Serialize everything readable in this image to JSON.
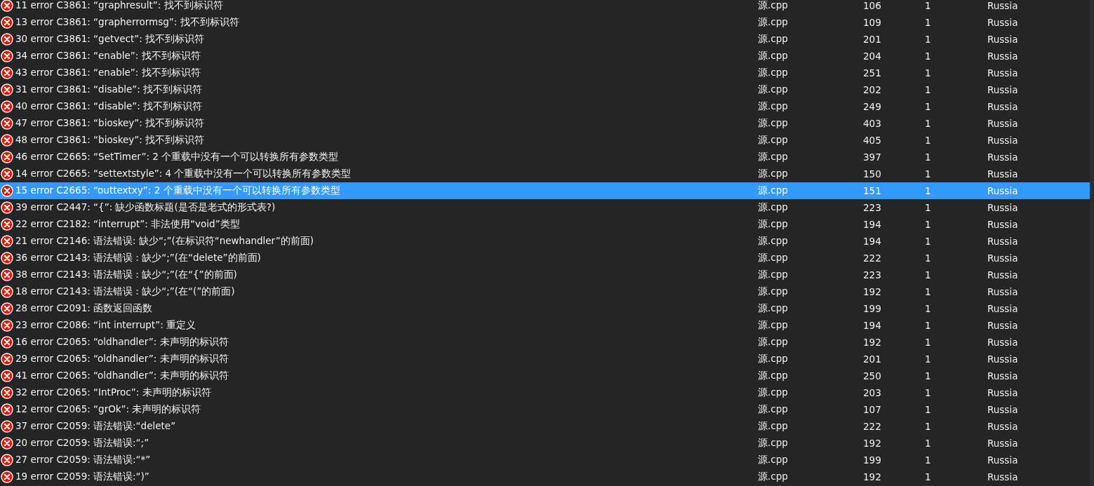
{
  "rows": [
    {
      "column_1": "11 error C3861: “graphresult”:  找不到标识符",
      "column_2": "源.cpp",
      "column_3": "106",
      "column_4": "1",
      "column_5": "Russia",
      "selected": false
    },
    {
      "column_1": "13 error C3861: “grapherrormsg”:  找不到标识符",
      "column_2": "源.cpp",
      "column_3": "109",
      "column_4": "1",
      "column_5": "Russia",
      "selected": false
    },
    {
      "column_1": "30 error C3861: “getvect”:  找不到标识符",
      "column_2": "源.cpp",
      "column_3": "201",
      "column_4": "1",
      "column_5": "Russia",
      "selected": false
    },
    {
      "column_1": "34 error C3861: “enable”:  找不到标识符",
      "column_2": "源.cpp",
      "column_3": "204",
      "column_4": "1",
      "column_5": "Russia",
      "selected": false
    },
    {
      "column_1": "43 error C3861: “enable”:  找不到标识符",
      "column_2": "源.cpp",
      "column_3": "251",
      "column_4": "1",
      "column_5": "Russia",
      "selected": false
    },
    {
      "column_1": "31 error C3861: “disable”:  找不到标识符",
      "column_2": "源.cpp",
      "column_3": "202",
      "column_4": "1",
      "column_5": "Russia",
      "selected": false
    },
    {
      "column_1": "40 error C3861: “disable”:  找不到标识符",
      "column_2": "源.cpp",
      "column_3": "249",
      "column_4": "1",
      "column_5": "Russia",
      "selected": false
    },
    {
      "column_1": "47 error C3861: “bioskey”:  找不到标识符",
      "column_2": "源.cpp",
      "column_3": "403",
      "column_4": "1",
      "column_5": "Russia",
      "selected": false
    },
    {
      "column_1": "48 error C3861: “bioskey”:  找不到标识符",
      "column_2": "源.cpp",
      "column_3": "405",
      "column_4": "1",
      "column_5": "Russia",
      "selected": false
    },
    {
      "column_1": "46 error C2665: “SetTimer”: 2 个重载中没有一个可以转换所有参数类型",
      "column_2": "源.cpp",
      "column_3": "397",
      "column_4": "1",
      "column_5": "Russia",
      "selected": false
    },
    {
      "column_1": "14 error C2665: “settextstyle”: 4 个重载中没有一个可以转换所有参数类型",
      "column_2": "源.cpp",
      "column_3": "150",
      "column_4": "1",
      "column_5": "Russia",
      "selected": false
    },
    {
      "column_1": "15 error C2665: “outtextxy”: 2 个重载中没有一个可以转换所有参数类型",
      "column_2": "源.cpp",
      "column_3": "151",
      "column_4": "1",
      "column_5": "Russia",
      "selected": true
    },
    {
      "column_1": "39 error C2447: “{”: 缺少函数标题(是否是老式的形式表?)",
      "column_2": "源.cpp",
      "column_3": "223",
      "column_4": "1",
      "column_5": "Russia",
      "selected": false
    },
    {
      "column_1": "22 error C2182: “interrupt”: 非法使用“void”类型",
      "column_2": "源.cpp",
      "column_3": "194",
      "column_4": "1",
      "column_5": "Russia",
      "selected": false
    },
    {
      "column_1": "21 error C2146: 语法错误: 缺少“;”(在标识符“newhandler”的前面)",
      "column_2": "源.cpp",
      "column_3": "194",
      "column_4": "1",
      "column_5": "Russia",
      "selected": false
    },
    {
      "column_1": "36 error C2143: 语法错误 : 缺少“;”(在“delete”的前面)",
      "column_2": "源.cpp",
      "column_3": "222",
      "column_4": "1",
      "column_5": "Russia",
      "selected": false
    },
    {
      "column_1": "38 error C2143: 语法错误 : 缺少“;”(在“{”的前面)",
      "column_2": "源.cpp",
      "column_3": "223",
      "column_4": "1",
      "column_5": "Russia",
      "selected": false
    },
    {
      "column_1": "18 error C2143: 语法错误 : 缺少“;”(在“(”的前面)",
      "column_2": "源.cpp",
      "column_3": "192",
      "column_4": "1",
      "column_5": "Russia",
      "selected": false
    },
    {
      "column_1": "28 error C2091: 函数返回函数",
      "column_2": "源.cpp",
      "column_3": "199",
      "column_4": "1",
      "column_5": "Russia",
      "selected": false
    },
    {
      "column_1": "23 error C2086: “int interrupt”: 重定义",
      "column_2": "源.cpp",
      "column_3": "194",
      "column_4": "1",
      "column_5": "Russia",
      "selected": false
    },
    {
      "column_1": "16 error C2065: “oldhandler”: 未声明的标识符",
      "column_2": "源.cpp",
      "column_3": "192",
      "column_4": "1",
      "column_5": "Russia",
      "selected": false
    },
    {
      "column_1": "29 error C2065: “oldhandler”: 未声明的标识符",
      "column_2": "源.cpp",
      "column_3": "201",
      "column_4": "1",
      "column_5": "Russia",
      "selected": false
    },
    {
      "column_1": "41 error C2065: “oldhandler”: 未声明的标识符",
      "column_2": "源.cpp",
      "column_3": "250",
      "column_4": "1",
      "column_5": "Russia",
      "selected": false
    },
    {
      "column_1": "32 error C2065: “IntProc”: 未声明的标识符",
      "column_2": "源.cpp",
      "column_3": "203",
      "column_4": "1",
      "column_5": "Russia",
      "selected": false
    },
    {
      "column_1": "12 error C2065: “grOk”: 未声明的标识符",
      "column_2": "源.cpp",
      "column_3": "107",
      "column_4": "1",
      "column_5": "Russia",
      "selected": false
    },
    {
      "column_1": "37 error C2059: 语法错误:“delete”",
      "column_2": "源.cpp",
      "column_3": "222",
      "column_4": "1",
      "column_5": "Russia",
      "selected": false
    },
    {
      "column_1": "20 error C2059: 语法错误:“;”",
      "column_2": "源.cpp",
      "column_3": "192",
      "column_4": "1",
      "column_5": "Russia",
      "selected": false
    },
    {
      "column_1": "27 error C2059: 语法错误:“*”",
      "column_2": "源.cpp",
      "column_3": "199",
      "column_4": "1",
      "column_5": "Russia",
      "selected": false
    },
    {
      "column_1": "19 error C2059: 语法错误:“)”",
      "column_2": "源.cpp",
      "column_3": "192",
      "column_4": "1",
      "column_5": "Russia",
      "selected": false
    }
  ]
}
